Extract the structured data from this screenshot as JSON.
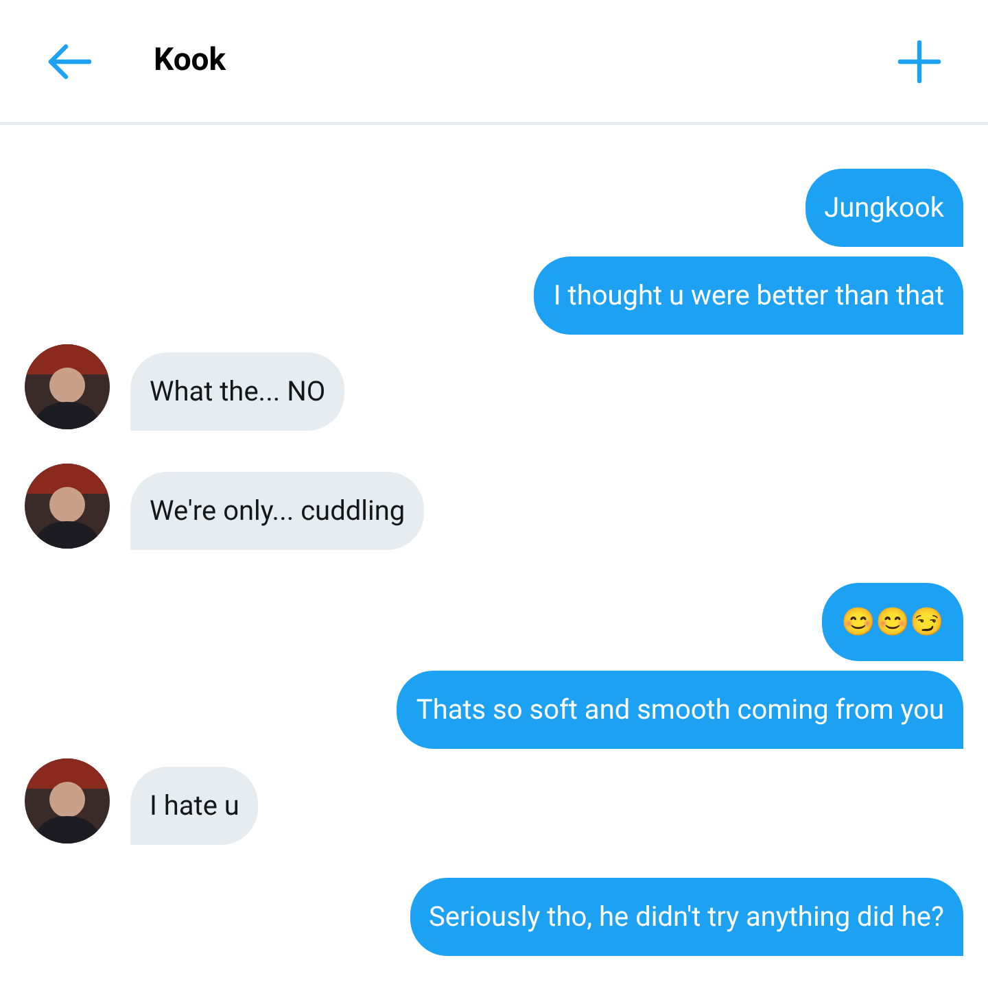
{
  "header": {
    "title": "Kook"
  },
  "messages": [
    {
      "kind": "outgoing",
      "text": "Jungkook"
    },
    {
      "kind": "outgoing",
      "text": "I thought u were better than that"
    },
    {
      "kind": "incoming",
      "text": "What the... NO"
    },
    {
      "kind": "incoming",
      "text": "We're only... cuddling"
    },
    {
      "kind": "outgoing",
      "text": "😊😊😏"
    },
    {
      "kind": "outgoing",
      "text": "Thats so soft and smooth coming from you"
    },
    {
      "kind": "incoming",
      "text": "I hate u"
    },
    {
      "kind": "outgoing",
      "text": "Seriously tho, he didn't try anything did he?"
    }
  ]
}
